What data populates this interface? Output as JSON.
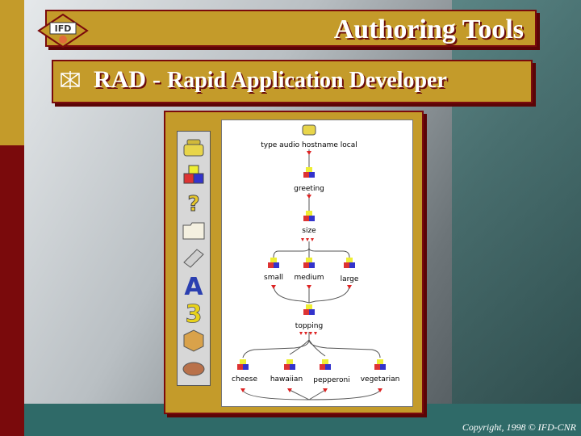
{
  "slide": {
    "title": "Authoring Tools",
    "heading_abbr": "RAD",
    "heading_sep": "-",
    "heading_full": "Rapid Application Developer",
    "copyright": "Copyright, 1998 © IFD-CNR"
  },
  "logo": {
    "text": "IFD"
  },
  "palette": {
    "items": [
      {
        "icon": "telephone-icon"
      },
      {
        "icon": "blocks-icon"
      },
      {
        "icon": "question-icon"
      },
      {
        "icon": "folder-icon"
      },
      {
        "icon": "keyboard-icon"
      },
      {
        "icon": "letter-a-icon"
      },
      {
        "icon": "number-three-icon"
      },
      {
        "icon": "box-icon"
      },
      {
        "icon": "handshake-icon"
      }
    ]
  },
  "flow": {
    "nodes": [
      {
        "id": "start",
        "label": "type audio hostname local"
      },
      {
        "id": "greeting",
        "label": "greeting"
      },
      {
        "id": "size",
        "label": "size"
      },
      {
        "id": "small",
        "label": "small"
      },
      {
        "id": "medium",
        "label": "medium"
      },
      {
        "id": "large",
        "label": "large"
      },
      {
        "id": "topping",
        "label": "topping"
      },
      {
        "id": "cheese",
        "label": "cheese"
      },
      {
        "id": "hawaiian",
        "label": "hawaiian"
      },
      {
        "id": "pepperoni",
        "label": "pepperoni"
      },
      {
        "id": "vegetarian",
        "label": "vegetarian"
      }
    ]
  },
  "colors": {
    "gold": "#c49b2a",
    "maroon": "#7a0a0c",
    "teal": "#2f6a68"
  }
}
